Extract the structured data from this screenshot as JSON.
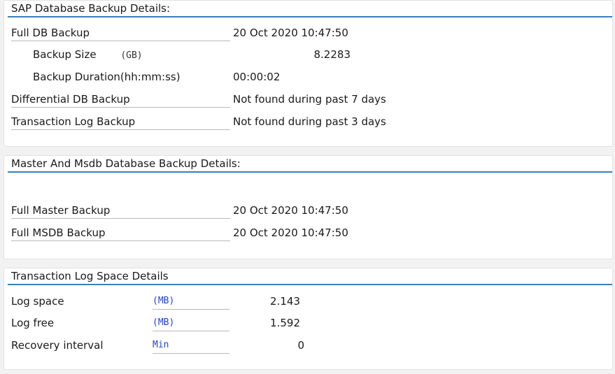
{
  "sap_backup": {
    "title": "SAP Database Backup Details:",
    "full_db_label": "Full DB Backup",
    "full_db_value": "20 Oct 2020 10:47:50",
    "backup_size_label": "Backup Size",
    "backup_size_unit": "(GB)",
    "backup_size_value": "8.2283",
    "backup_duration_label": "Backup Duration(hh:mm:ss)",
    "backup_duration_value": "00:00:02",
    "differential_label": "Differential DB Backup",
    "differential_value": "Not found during past 7 days",
    "translog_label": "Transaction Log Backup",
    "translog_value": "Not found during past 3 days"
  },
  "master_msdb": {
    "title": "Master And Msdb Database Backup Details:",
    "full_master_label": "Full Master Backup",
    "full_master_value": "20 Oct 2020 10:47:50",
    "full_msdb_label": "Full MSDB Backup",
    "full_msdb_value": "20 Oct 2020 10:47:50"
  },
  "log_space": {
    "title": "Transaction Log Space Details",
    "rows": [
      {
        "label": "Log space",
        "unit": "(MB)",
        "value": "2.143"
      },
      {
        "label": "Log free",
        "unit": "(MB)",
        "value": "1.592"
      },
      {
        "label": "Recovery interval",
        "unit": "Min",
        "value": "0"
      }
    ]
  },
  "colors": {
    "accent_rule": "#3a7fb8",
    "unit_text": "#2447c8"
  }
}
